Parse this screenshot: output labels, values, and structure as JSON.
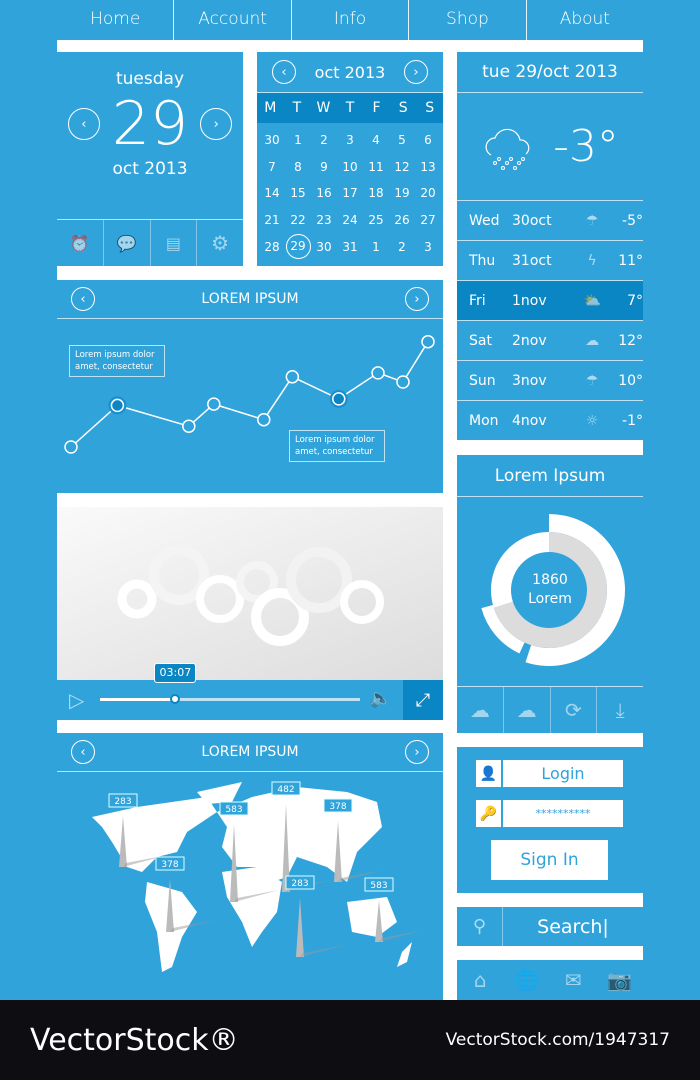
{
  "nav": [
    "Home",
    "Account",
    "Info",
    "Shop",
    "About"
  ],
  "date_widget": {
    "weekday": "tuesday",
    "day": "29",
    "month_year": "oct 2013",
    "icons": [
      "alarm-clock-icon",
      "chat-icon",
      "document-icon",
      "gear-icon"
    ]
  },
  "calendar": {
    "title": "oct 2013",
    "weekdays": [
      "M",
      "T",
      "W",
      "T",
      "F",
      "S",
      "S"
    ],
    "days": [
      "30",
      "1",
      "2",
      "3",
      "4",
      "5",
      "6",
      "7",
      "8",
      "9",
      "10",
      "11",
      "12",
      "13",
      "14",
      "15",
      "16",
      "17",
      "18",
      "19",
      "20",
      "21",
      "22",
      "23",
      "24",
      "25",
      "26",
      "27",
      "28",
      "29",
      "30",
      "31",
      "1",
      "2",
      "3"
    ],
    "selected": "29"
  },
  "weather": {
    "title": "tue 29/oct 2013",
    "current_temp": "-3°",
    "current_icon": "snow-cloud-icon",
    "forecast": [
      {
        "day": "Wed",
        "date": "30oct",
        "icon": "rain-icon",
        "temp": "-5°"
      },
      {
        "day": "Thu",
        "date": "31oct",
        "icon": "thunder-icon",
        "temp": "11°"
      },
      {
        "day": "Fri",
        "date": "1nov",
        "icon": "partly-sunny-icon",
        "temp": "7°",
        "selected": true
      },
      {
        "day": "Sat",
        "date": "2nov",
        "icon": "cloud-icon",
        "temp": "12°"
      },
      {
        "day": "Sun",
        "date": "3nov",
        "icon": "rain-icon",
        "temp": "10°"
      },
      {
        "day": "Mon",
        "date": "4nov",
        "icon": "sun-icon",
        "temp": "-1°"
      }
    ]
  },
  "chart_panel": {
    "title": "LOREM IPSUM",
    "tooltip1": [
      "Lorem ipsum dolor",
      "amet,  consectetur"
    ],
    "tooltip2": [
      "Lorem ipsum dolor",
      "amet,  consectetur"
    ]
  },
  "chart_data": {
    "type": "line",
    "x": [
      0,
      13,
      33,
      40,
      54,
      62,
      75,
      86,
      93,
      100
    ],
    "values": [
      10,
      42,
      26,
      43,
      31,
      64,
      47,
      67,
      60,
      91
    ],
    "highlighted": [
      1,
      6
    ],
    "grid": false
  },
  "video": {
    "time": "03:07",
    "progress": 0.29
  },
  "map_panel": {
    "title": "LOREM IPSUM",
    "pins": [
      "283",
      "378",
      "583",
      "482",
      "378",
      "283",
      "583"
    ]
  },
  "donut": {
    "title": "Lorem Ipsum",
    "value": "1860",
    "label": "Lorem",
    "outer_fraction": 0.55,
    "inner_fraction": 0.7,
    "icons": [
      "cloud-download-icon",
      "cloud-upload-icon",
      "refresh-icon",
      "download-icon"
    ]
  },
  "login": {
    "username": "Login",
    "password": "**********",
    "submit": "Sign In"
  },
  "search": {
    "value": "Search|"
  },
  "bottom_icons": [
    "home-icon",
    "globe-icon",
    "mail-icon",
    "camera-icon"
  ],
  "colors": {
    "primary": "#30a3db",
    "dark": "#0a86c4",
    "white": "#ffffff"
  },
  "watermark": {
    "brand": "VectorStock®",
    "id": "VectorStock.com/1947317"
  }
}
